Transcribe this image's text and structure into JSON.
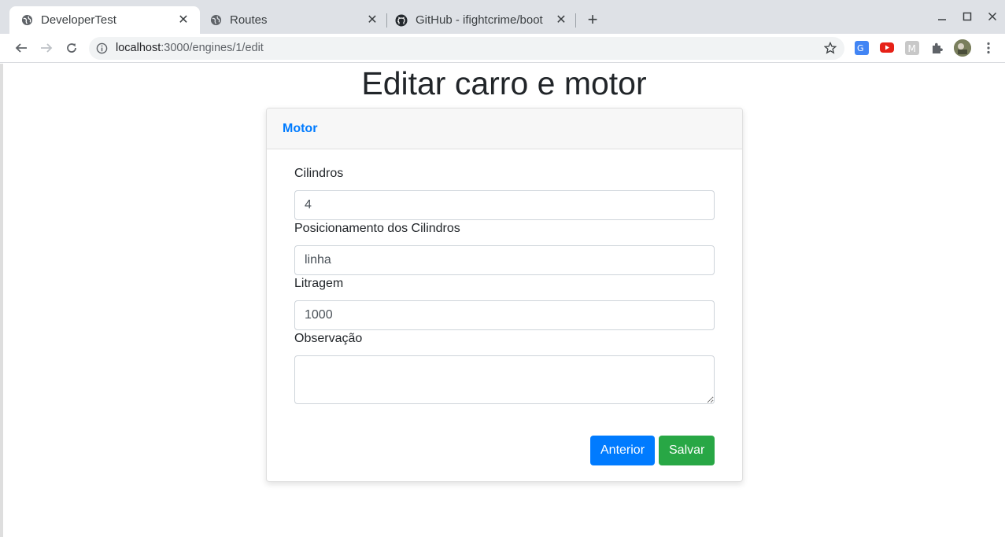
{
  "browser": {
    "tabs": [
      {
        "title": "DeveloperTest",
        "active": true,
        "icon": "globe-icon"
      },
      {
        "title": "Routes",
        "active": false,
        "icon": "globe-icon"
      },
      {
        "title": "GitHub - ifightcrime/boot",
        "active": false,
        "icon": "github-icon"
      }
    ],
    "url_host": "localhost",
    "url_path": ":3000/engines/1/edit"
  },
  "page": {
    "title": "Editar carro e motor"
  },
  "card": {
    "header": "Motor",
    "fields": [
      {
        "label": "Cilindros",
        "value": "4"
      },
      {
        "label": "Posicionamento dos Cilindros",
        "value": "linha"
      },
      {
        "label": "Litragem",
        "value": "1000"
      },
      {
        "label": "Observação",
        "value": ""
      }
    ],
    "buttons": {
      "previous": "Anterior",
      "save": "Salvar"
    }
  },
  "colors": {
    "primary": "#007bff",
    "success": "#28a745"
  }
}
